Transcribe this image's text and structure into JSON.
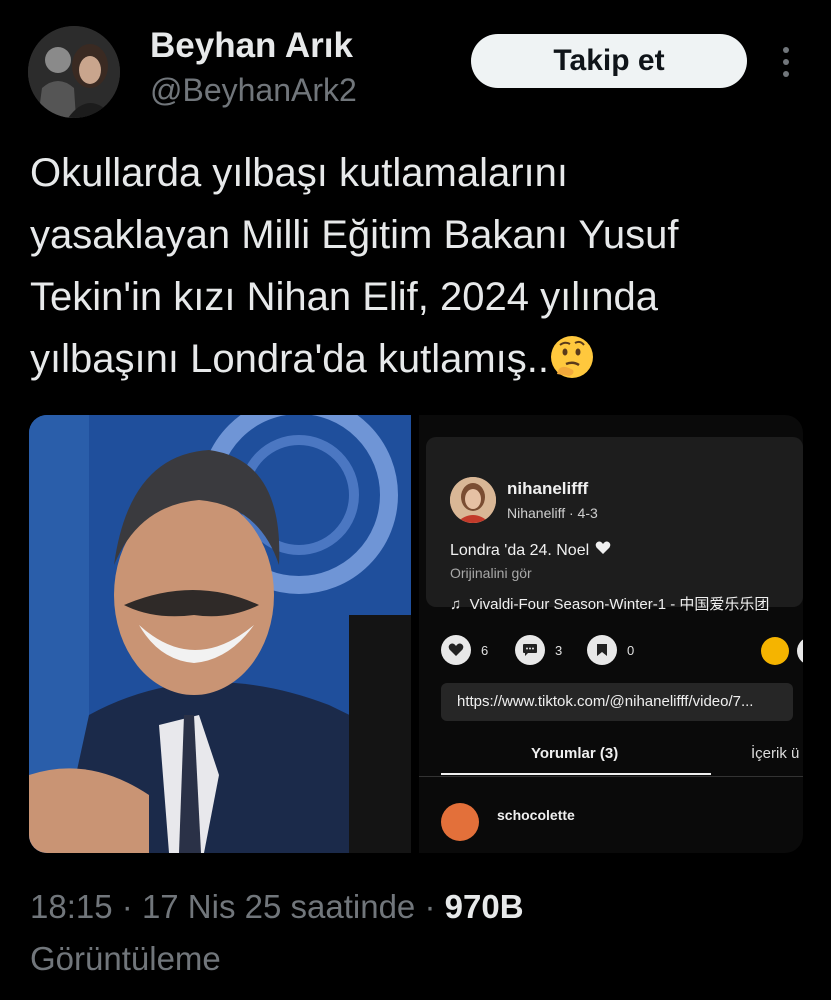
{
  "author": {
    "name": "Beyhan Arık",
    "handle": "@BeyhanArk2",
    "follow_label": "Takip et"
  },
  "tweet": {
    "lines": [
      "Okullarda yılbaşı kutlamalarını",
      "yasaklayan Milli Eğitim Bakanı Yusuf",
      "Tekin'in kızı Nihan Elif, 2024 yılında",
      "yılbaşını Londra'da kutlamış.."
    ],
    "emoji": "thinking-face"
  },
  "tiktok": {
    "username": "nihanelifff",
    "subline": "Nihaneliff · 4-3",
    "caption": "Londra 'da 24. Noel",
    "original_link": "Orijinalini gör",
    "music": "Vivaldi-Four Season-Winter-1 - 中国爱乐乐团",
    "likes": "6",
    "comments": "3",
    "saves": "0",
    "url": "https://www.tiktok.com/@nihanelifff/video/7...",
    "tab_comments": "Yorumlar (3)",
    "tab_other": "İçerik ü",
    "commenter": "schocolette"
  },
  "meta": {
    "time": "18:15",
    "separator": "·",
    "date": "17 Nis 25 saatinde",
    "views": "970B",
    "views_label": "Görüntüleme"
  },
  "colors": {
    "background": "#000000",
    "text": "#e7e9ea",
    "muted": "#71767b",
    "follow_bg": "#eff3f4"
  }
}
